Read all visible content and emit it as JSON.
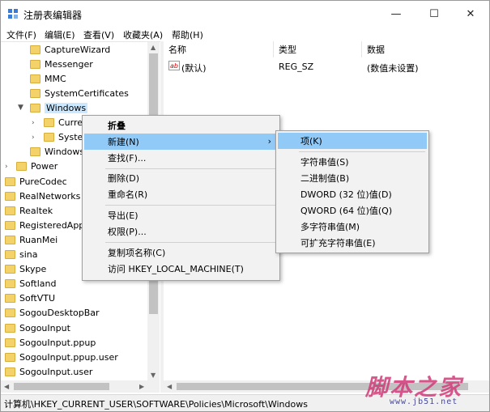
{
  "window": {
    "title": "注册表编辑器"
  },
  "menubar": {
    "items": [
      "文件(F)",
      "编辑(E)",
      "查看(V)",
      "收藏夹(A)",
      "帮助(H)"
    ]
  },
  "tree": {
    "rows": [
      {
        "label": "CaptureWizard"
      },
      {
        "label": "Messenger"
      },
      {
        "label": "MMC"
      },
      {
        "label": "SystemCertificates"
      },
      {
        "label": "Windows"
      },
      {
        "label": "Curre"
      },
      {
        "label": "Syster"
      },
      {
        "label": "Windows"
      },
      {
        "label": "Power"
      },
      {
        "label": "PureCodec"
      },
      {
        "label": "RealNetworks"
      },
      {
        "label": "Realtek"
      },
      {
        "label": "RegisteredAppl"
      },
      {
        "label": "RuanMei"
      },
      {
        "label": "sina"
      },
      {
        "label": "Skype"
      },
      {
        "label": "Softland"
      },
      {
        "label": "SoftVTU"
      },
      {
        "label": "SogouDesktopBar"
      },
      {
        "label": "SogouInput"
      },
      {
        "label": "SogouInput.ppup"
      },
      {
        "label": "SogouInput.ppup.user"
      },
      {
        "label": "SogouInput.user"
      }
    ]
  },
  "list": {
    "columns": [
      "名称",
      "类型",
      "数据"
    ],
    "rows": [
      {
        "name": "(默认)",
        "type": "REG_SZ",
        "data": "(数值未设置)"
      }
    ]
  },
  "context_menu": {
    "items": [
      {
        "label": "折叠"
      },
      {
        "label": "新建(N)"
      },
      {
        "label": "查找(F)..."
      },
      {
        "label": "删除(D)"
      },
      {
        "label": "重命名(R)"
      },
      {
        "label": "导出(E)"
      },
      {
        "label": "权限(P)..."
      },
      {
        "label": "复制项名称(C)"
      },
      {
        "label": "访问 HKEY_LOCAL_MACHINE(T)"
      }
    ]
  },
  "submenu": {
    "items": [
      {
        "label": "项(K)"
      },
      {
        "label": "字符串值(S)"
      },
      {
        "label": "二进制值(B)"
      },
      {
        "label": "DWORD (32 位)值(D)"
      },
      {
        "label": "QWORD (64 位)值(Q)"
      },
      {
        "label": "多字符串值(M)"
      },
      {
        "label": "可扩充字符串值(E)"
      }
    ]
  },
  "statusbar": {
    "path": "计算机\\HKEY_CURRENT_USER\\SOFTWARE\\Policies\\Microsoft\\Windows"
  },
  "watermark": {
    "text": "脚本之家",
    "url": "www.jb51.net"
  },
  "colors": {
    "menu_highlight": "#91c9f7",
    "folder": "#f4d26a",
    "watermark": "#d13b7a"
  }
}
